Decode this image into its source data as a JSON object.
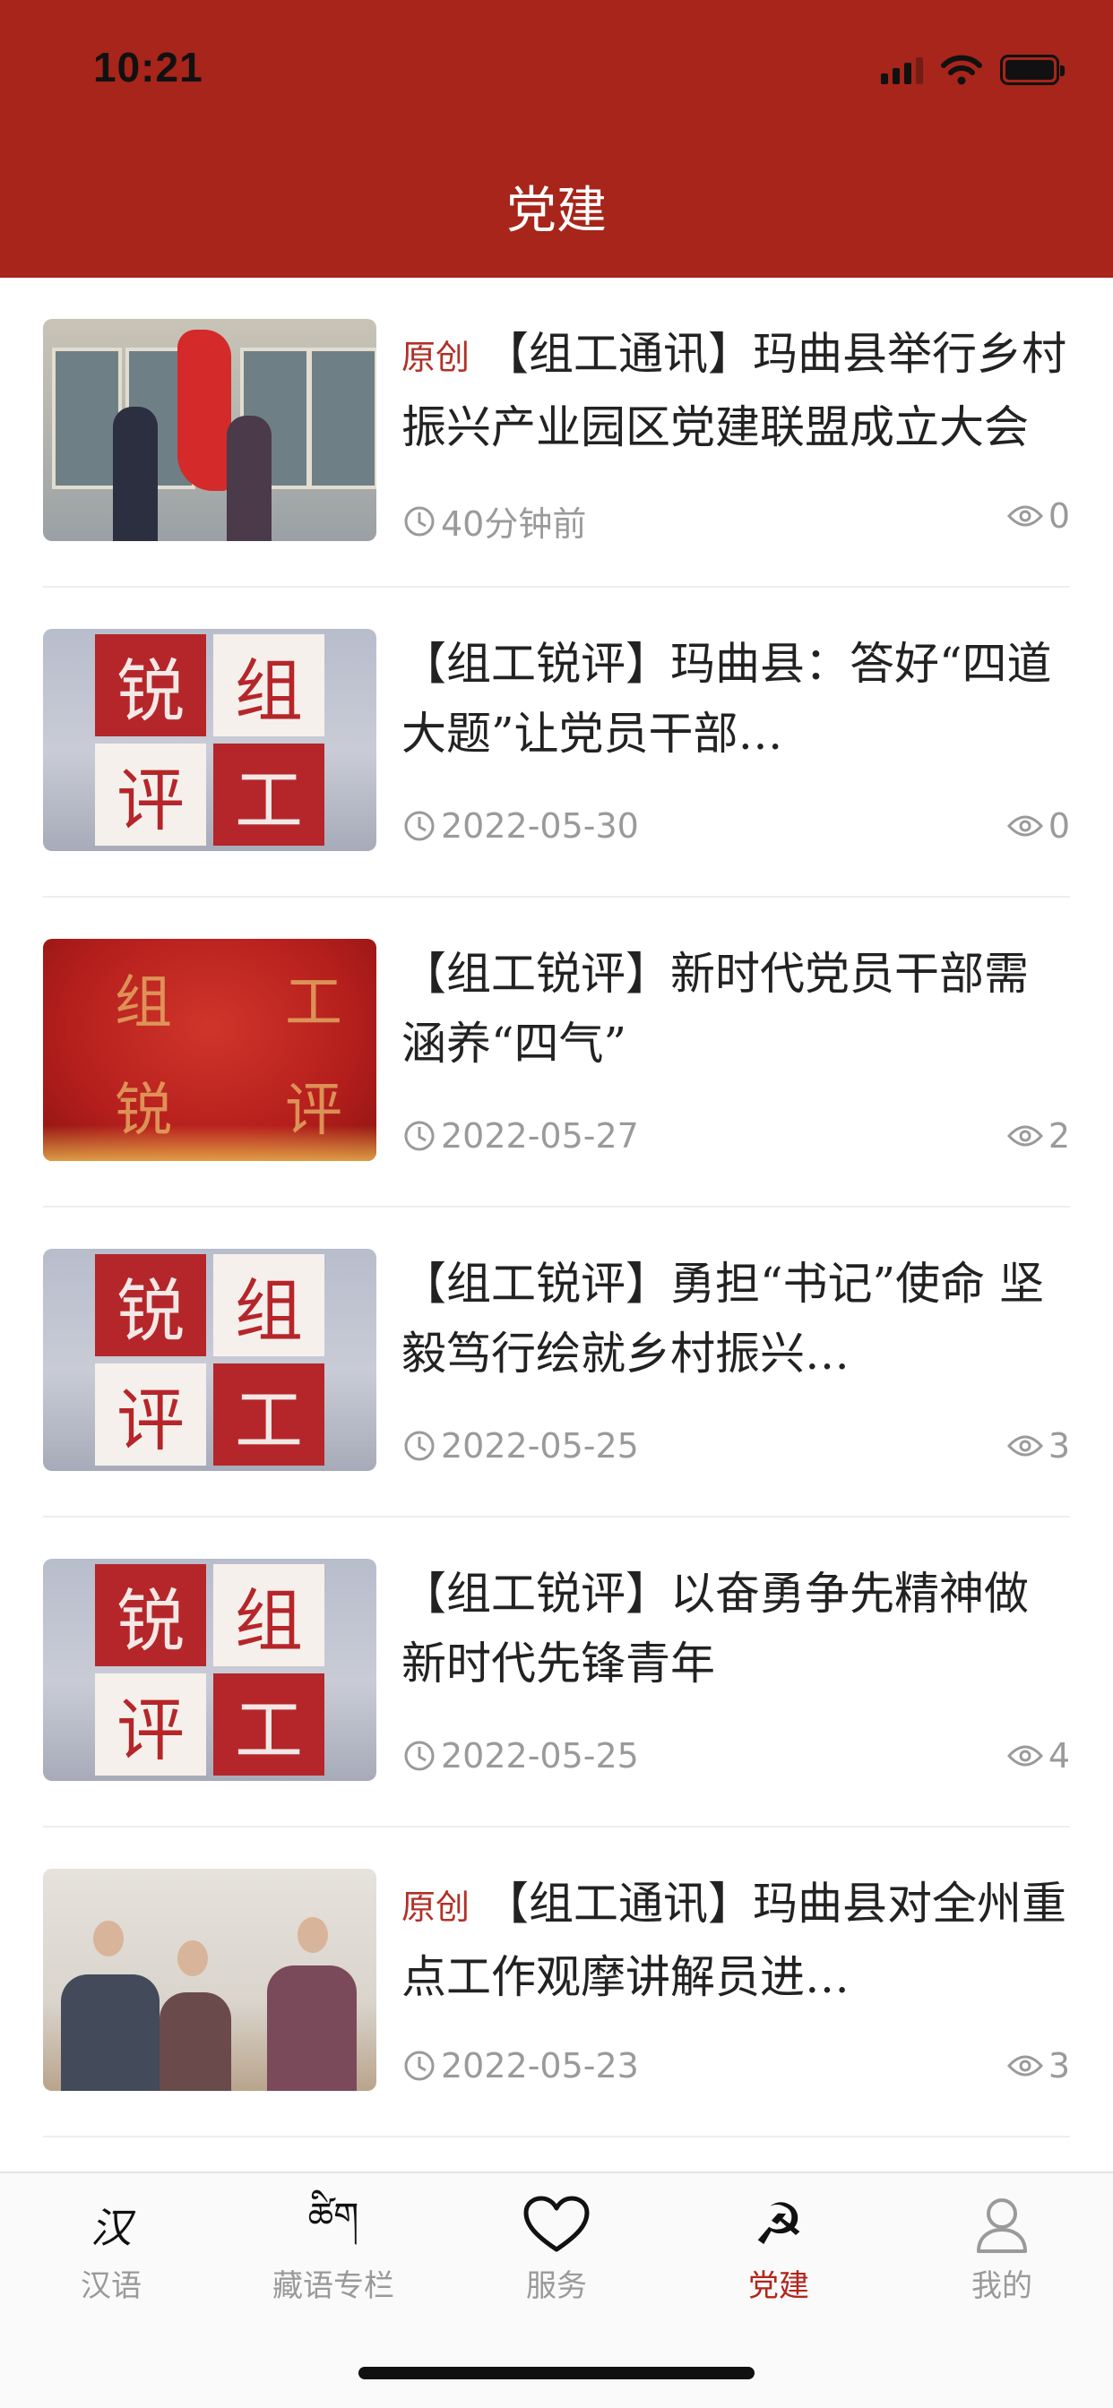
{
  "status_bar": {
    "time": "10:21"
  },
  "header": {
    "title": "党建"
  },
  "articles": [
    {
      "tag": "原创",
      "title": "【组工通讯】玛曲县举行乡村振兴产业园区党建联盟成立大会",
      "time": "40分钟前",
      "views": "0",
      "thumb": "photo-ceremony"
    },
    {
      "tag": "",
      "title": "【组工锐评】玛曲县：答好“四道大题”让党员干部…",
      "time": "2022-05-30",
      "views": "0",
      "thumb": "comment-logo"
    },
    {
      "tag": "",
      "title": "【组工锐评】新时代党员干部需涵养“四气”",
      "time": "2022-05-27",
      "views": "2",
      "thumb": "red-banner"
    },
    {
      "tag": "",
      "title": "【组工锐评】勇担“书记”使命 坚毅笃行绘就乡村振兴…",
      "time": "2022-05-25",
      "views": "3",
      "thumb": "comment-logo"
    },
    {
      "tag": "",
      "title": "【组工锐评】以奋勇争先精神做新时代先锋青年",
      "time": "2022-05-25",
      "views": "4",
      "thumb": "comment-logo"
    },
    {
      "tag": "原创",
      "title": "【组工通讯】玛曲县对全州重点工作观摩讲解员进…",
      "time": "2022-05-23",
      "views": "3",
      "thumb": "photo-bus"
    }
  ],
  "thumb_text": {
    "c1": "锐",
    "c2": "组",
    "c3": "评",
    "c4": "工"
  },
  "tabbar": {
    "items": [
      {
        "label": "汉语",
        "icon": "han-character-icon",
        "glyph": "汉"
      },
      {
        "label": "藏语专栏",
        "icon": "tibetan-script-icon",
        "glyph": "ཚིག"
      },
      {
        "label": "服务",
        "icon": "heart-icon",
        "glyph": ""
      },
      {
        "label": "党建",
        "icon": "party-emblem-icon",
        "glyph": "☭"
      },
      {
        "label": "我的",
        "icon": "user-icon",
        "glyph": ""
      }
    ],
    "active_index": 3
  },
  "colors": {
    "header": "#a7251a",
    "accent": "#b3241b",
    "meta": "#9a9a9a"
  }
}
